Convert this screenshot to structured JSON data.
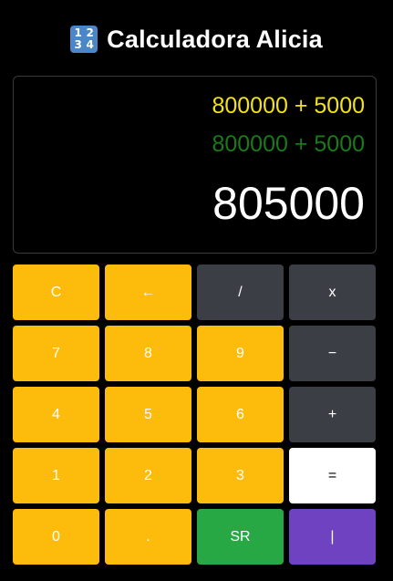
{
  "header": {
    "icon_digits": [
      "1",
      "2",
      "3",
      "4"
    ],
    "title": "Calculadora Alicia"
  },
  "display": {
    "expression_current": "800000 + 5000",
    "expression_history": "800000 + 5000",
    "result": "805000",
    "colors": {
      "current": "#f2e21a",
      "history": "#1a7a1a",
      "result": "#ffffff"
    }
  },
  "keys": [
    {
      "label": "C",
      "style": "yellow"
    },
    {
      "label": "←",
      "style": "yellow"
    },
    {
      "label": "/",
      "style": "gray"
    },
    {
      "label": "x",
      "style": "gray"
    },
    {
      "label": "7",
      "style": "yellow"
    },
    {
      "label": "8",
      "style": "yellow"
    },
    {
      "label": "9",
      "style": "yellow"
    },
    {
      "label": "−",
      "style": "gray"
    },
    {
      "label": "4",
      "style": "yellow"
    },
    {
      "label": "5",
      "style": "yellow"
    },
    {
      "label": "6",
      "style": "yellow"
    },
    {
      "label": "+",
      "style": "gray"
    },
    {
      "label": "1",
      "style": "yellow"
    },
    {
      "label": "2",
      "style": "yellow"
    },
    {
      "label": "3",
      "style": "yellow"
    },
    {
      "label": "=",
      "style": "white"
    },
    {
      "label": "0",
      "style": "yellow"
    },
    {
      "label": ".",
      "style": "yellow"
    },
    {
      "label": "SR",
      "style": "green"
    },
    {
      "label": "|",
      "style": "purple"
    }
  ],
  "colors": {
    "background": "#000000",
    "yellow_key": "#fdbb0b",
    "gray_key": "#3b3e44",
    "white_key": "#ffffff",
    "green_key": "#28a745",
    "purple_key": "#6f42c1"
  }
}
